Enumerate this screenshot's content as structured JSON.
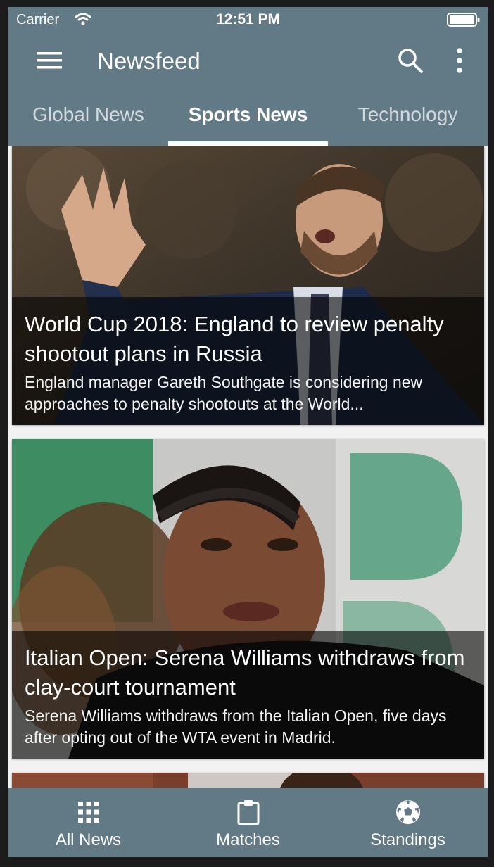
{
  "status_bar": {
    "carrier": "Carrier",
    "time": "12:51 PM"
  },
  "toolbar": {
    "title": "Newsfeed",
    "icons": [
      "menu-icon",
      "search-icon",
      "more-vertical-icon"
    ]
  },
  "tabs": [
    {
      "label": "Global News",
      "active": false
    },
    {
      "label": "Sports News",
      "active": true
    },
    {
      "label": "Technology",
      "active": false
    }
  ],
  "articles": [
    {
      "title": "World Cup 2018: England to review penalty shootout plans in Russia",
      "description": "England manager Gareth Southgate is considering new approaches to penalty shootouts at the World..."
    },
    {
      "title": "Italian Open: Serena Williams withdraws from clay-court tournament",
      "description": "Serena Williams withdraws from the Italian Open, five days after opting out of the WTA event in Madrid."
    }
  ],
  "bottom_nav": [
    {
      "label": "All News",
      "icon": "grid-icon"
    },
    {
      "label": "Matches",
      "icon": "clipboard-icon"
    },
    {
      "label": "Standings",
      "icon": "soccer-ball-icon"
    }
  ],
  "colors": {
    "primary": "#627986",
    "background": "#f2f2f2",
    "text_on_primary": "#ffffff"
  }
}
